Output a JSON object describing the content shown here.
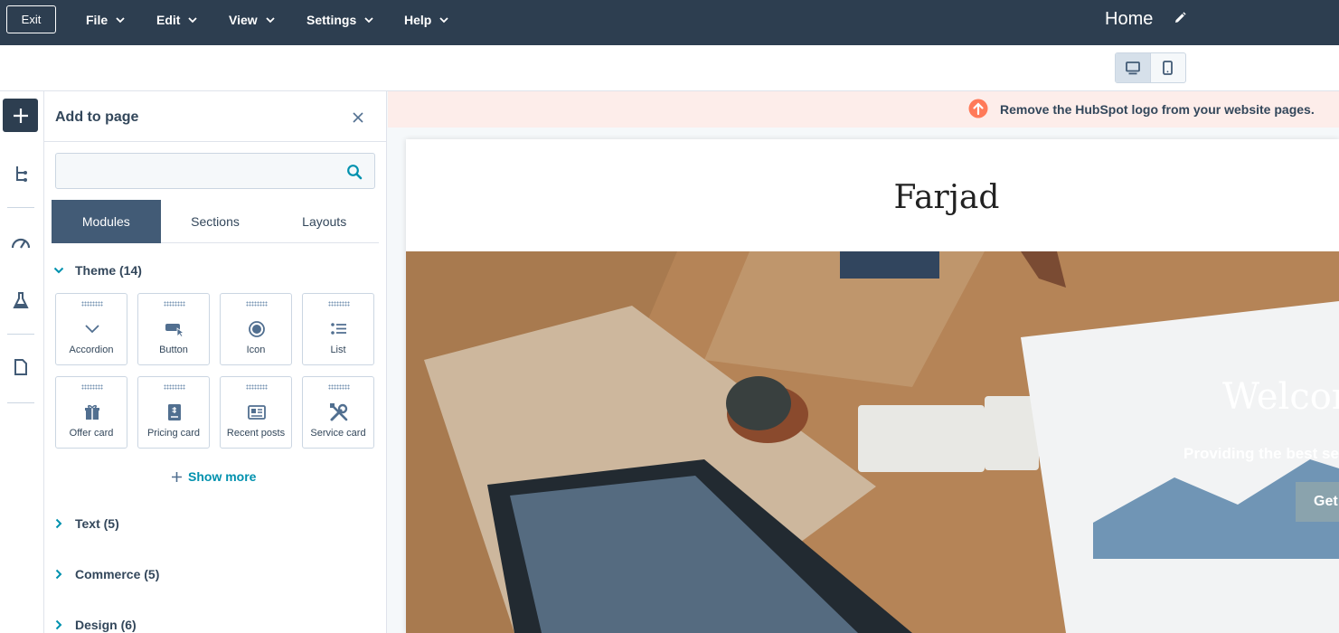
{
  "topbar": {
    "exit_label": "Exit",
    "menus": [
      "File",
      "Edit",
      "View",
      "Settings",
      "Help"
    ],
    "page_title": "Home"
  },
  "panel": {
    "title": "Add to page",
    "search_placeholder": "",
    "tabs": [
      "Modules",
      "Sections",
      "Layouts"
    ],
    "active_tab": "Modules",
    "groups": [
      {
        "label": "Theme (14)",
        "expanded": true
      },
      {
        "label": "Text (5)",
        "expanded": false
      },
      {
        "label": "Commerce (5)",
        "expanded": false
      },
      {
        "label": "Design (6)",
        "expanded": false
      }
    ],
    "modules": [
      {
        "label": "Accordion",
        "icon": "chevron-down-icon"
      },
      {
        "label": "Button",
        "icon": "button-cursor-icon"
      },
      {
        "label": "Icon",
        "icon": "circle-icon"
      },
      {
        "label": "List",
        "icon": "list-icon"
      },
      {
        "label": "Offer card",
        "icon": "gift-icon"
      },
      {
        "label": "Pricing card",
        "icon": "pricing-icon"
      },
      {
        "label": "Recent posts",
        "icon": "posts-icon"
      },
      {
        "label": "Service card",
        "icon": "tools-icon"
      }
    ],
    "show_more_label": "Show more"
  },
  "canvas": {
    "banner_text": "Remove the HubSpot logo from your website pages.",
    "site_logo": "Farjad",
    "hero_heading": "Welcome",
    "hero_subtext": "Providing the best serv",
    "hero_button": "Get"
  },
  "colors": {
    "topbar_bg": "#2d3e50",
    "tab_active": "#425b76",
    "link": "#0091ae",
    "banner_bg": "#fdedea",
    "banner_icon": "#ff7a59"
  }
}
